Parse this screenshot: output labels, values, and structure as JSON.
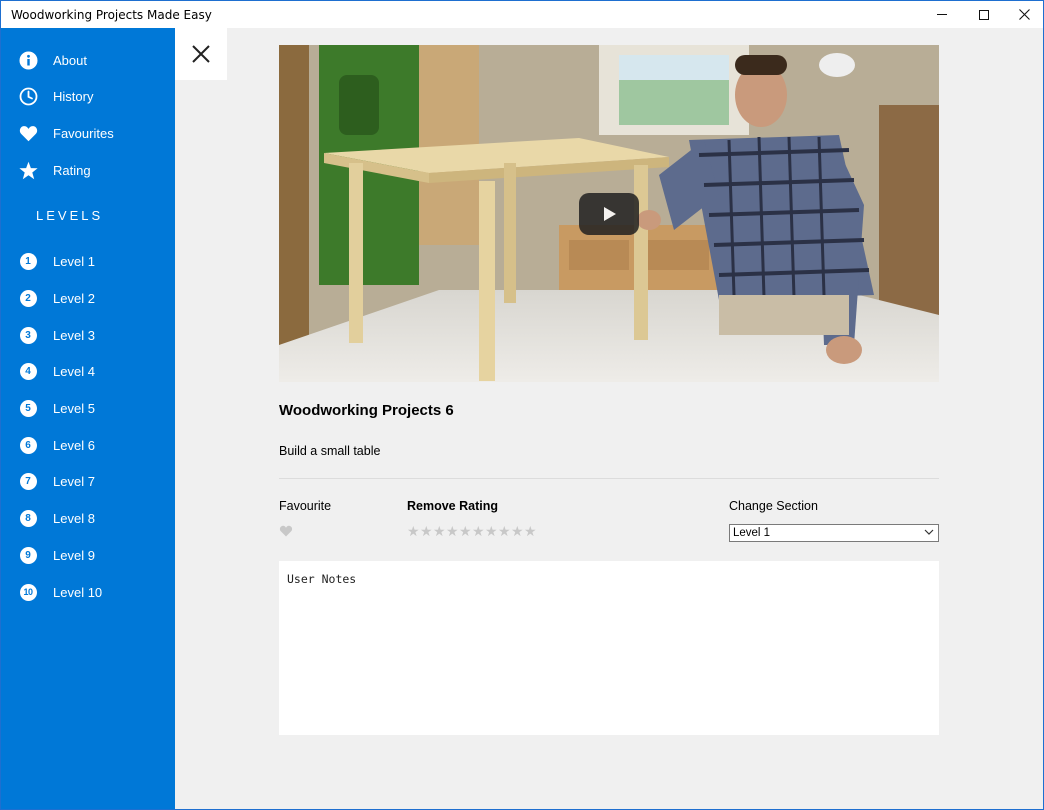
{
  "window": {
    "title": "Woodworking Projects Made Easy"
  },
  "sidebar": {
    "menu": [
      {
        "label": "About",
        "icon": "info-icon"
      },
      {
        "label": "History",
        "icon": "clock-icon"
      },
      {
        "label": "Favourites",
        "icon": "heart-icon"
      },
      {
        "label": "Rating",
        "icon": "star-icon"
      }
    ],
    "levels_heading": "LEVELS",
    "levels": [
      {
        "num": "1",
        "label": "Level 1"
      },
      {
        "num": "2",
        "label": "Level 2"
      },
      {
        "num": "3",
        "label": "Level 3"
      },
      {
        "num": "4",
        "label": "Level 4"
      },
      {
        "num": "5",
        "label": "Level 5"
      },
      {
        "num": "6",
        "label": "Level 6"
      },
      {
        "num": "7",
        "label": "Level 7"
      },
      {
        "num": "8",
        "label": "Level 8"
      },
      {
        "num": "9",
        "label": "Level 9"
      },
      {
        "num": "10",
        "label": "Level 10"
      }
    ]
  },
  "project": {
    "title": "Woodworking Projects 6",
    "description": "Build a small table",
    "favourite_label": "Favourite",
    "favourite_state": false,
    "rating_label": "Remove Rating",
    "rating_max": 10,
    "rating_value": 0,
    "section_label": "Change Section",
    "section_value": "Level 1",
    "notes_placeholder": "User Notes"
  },
  "colors": {
    "accent": "#0078d7",
    "background": "#f0f0f0",
    "star_inactive": "#c8c8c8"
  }
}
